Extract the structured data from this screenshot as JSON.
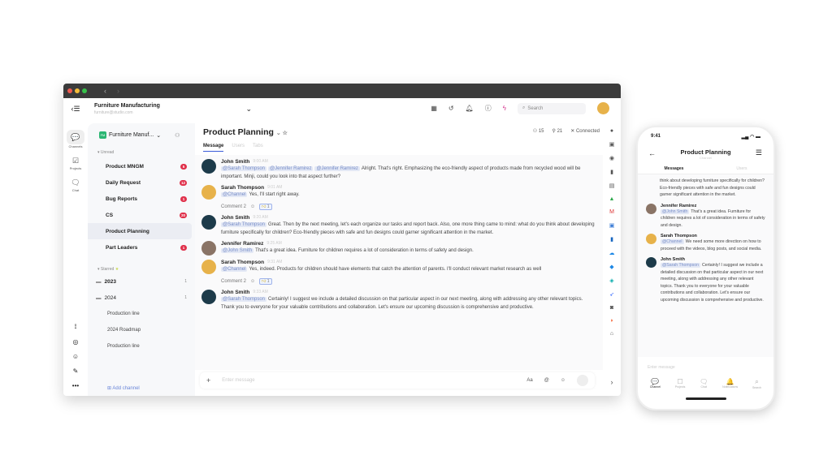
{
  "window": {
    "workspace_title": "Furniture Manufacturing",
    "workspace_sub": "furniture@studio.com",
    "nav_back": "‹",
    "nav_fwd": "›"
  },
  "rail": [
    {
      "label": "Channels",
      "icon": "💬"
    },
    {
      "label": "Projects",
      "icon": "☑"
    },
    {
      "label": "Chat",
      "icon": "🗨"
    }
  ],
  "rail_bottom": [
    "⟟",
    "◎",
    "☺",
    "✎",
    "•••"
  ],
  "sidebar": {
    "workspace": "Furniture Manuf...",
    "logo": "FM",
    "unread_label": "Unread",
    "channels": [
      {
        "name": "Product MNGM",
        "badge": "5"
      },
      {
        "name": "Daily Request",
        "badge": "12"
      },
      {
        "name": "Bug Reports",
        "badge": "1"
      },
      {
        "name": "CS",
        "badge": "20"
      },
      {
        "name": "Product Planning",
        "badge": "",
        "active": true
      },
      {
        "name": "Part Leaders",
        "badge": "1"
      }
    ],
    "starred_label": "Starred",
    "folders": [
      {
        "name": "2023",
        "count": "1"
      },
      {
        "name": "2024",
        "count": "1"
      }
    ],
    "subchannels": [
      "Production line",
      "2024 Roadmap",
      "Production line"
    ],
    "add_channel": "Add channel"
  },
  "topbar": {
    "search_placeholder": "Search"
  },
  "channel": {
    "title": "Product Planning",
    "members": "15",
    "pins": "21",
    "connection": "Connected",
    "tabs": [
      "Message",
      "Users",
      "Tabs"
    ]
  },
  "messages": [
    {
      "author": "John Smith",
      "time": "9:00 AM",
      "color": "#1d3b4a",
      "mentions": [
        "@Sarah Thompson",
        "@Jennifer Ramirez",
        "@Jennifer Ramirez"
      ],
      "text": "Alright. That's right. Emphasizing the eco-friendly aspect of products made from recycled wood will be important. Minji, could you look into that aspect further?"
    },
    {
      "author": "Sarah Thompson",
      "time": "9:01 AM",
      "color": "#e7b24a",
      "mentions": [
        "@Channel"
      ],
      "text": "Yes, I'll start right away.",
      "comment": "Comment 2",
      "reaction": "1"
    },
    {
      "author": "John Smith",
      "time": "9:20 AM",
      "color": "#1d3b4a",
      "mentions": [
        "@Sarah Thompson"
      ],
      "text": "Great. Then by the next meeting, let's each organize our tasks and report back. Also, one more thing came to mind: what do you think about developing furniture specifically for children? Eco-friendly pieces with safe and fun designs could garner significant attention in the market."
    },
    {
      "author": "Jennifer Ramirez",
      "time": "9:25 AM",
      "color": "#8a7466",
      "mentions": [
        "@John Smith"
      ],
      "text": "That's a great idea. Furniture for children requires a lot of consideration in terms of safety and design."
    },
    {
      "author": "Sarah Thompson",
      "time": "9:31 AM",
      "color": "#e7b24a",
      "mentions": [
        "@Channel"
      ],
      "text": "Yes, indeed. Products for children should have elements that catch the attention of parents. I'll conduct relevant market research as well",
      "comment": "Comment 2",
      "reaction": "1"
    },
    {
      "author": "John Smith",
      "time": "9:33 AM",
      "color": "#1d3b4a",
      "mentions": [
        "@Sarah Thompson"
      ],
      "text": "Certainly! I suggest we include a detailed discussion on that particular aspect in our next meeting, along with addressing any other relevant topics. Thank you to everyone for your valuable contributions and collaboration. Let's ensure our upcoming discussion is comprehensive and productive."
    }
  ],
  "input": {
    "placeholder": "Enter message"
  },
  "phone": {
    "time": "9:41",
    "title": "Product Planning",
    "subtitle": "Channel",
    "tabs": [
      "Messages",
      "Users"
    ],
    "leading_text": "think about developing furniture specifically for children? Eco-friendly pieces with safe and fun designs could garner significant attention in the market.",
    "messages": [
      {
        "author": "Jennifer Ramirez",
        "color": "#8a7466",
        "mention": "@John Smith",
        "text": "That's a great idea. Furniture for children requires a lot of consideration in terms of safety and design."
      },
      {
        "author": "Sarah Thompson",
        "color": "#e7b24a",
        "mention": "@Channel",
        "text": "We need some more direction on how to proceed with the videos, blog posts, and social media."
      },
      {
        "author": "John Smith",
        "color": "#1d3b4a",
        "mention": "@Sarah Thompson",
        "text": "Certainly! I suggest we include a detailed discussion on that particular aspect in our next meeting, along with addressing any other relevant topics. Thank you to everyone for your valuable contributions and collaboration. Let's ensure our upcoming discussion is comprehensive and productive."
      }
    ],
    "input_placeholder": "Enter message",
    "nav": [
      {
        "label": "Channel",
        "icon": "💬"
      },
      {
        "label": "Projects",
        "icon": "☐"
      },
      {
        "label": "Chat",
        "icon": "🗨"
      },
      {
        "label": "Notifications",
        "icon": "🔔"
      },
      {
        "label": "Search",
        "icon": "⌕"
      }
    ]
  }
}
